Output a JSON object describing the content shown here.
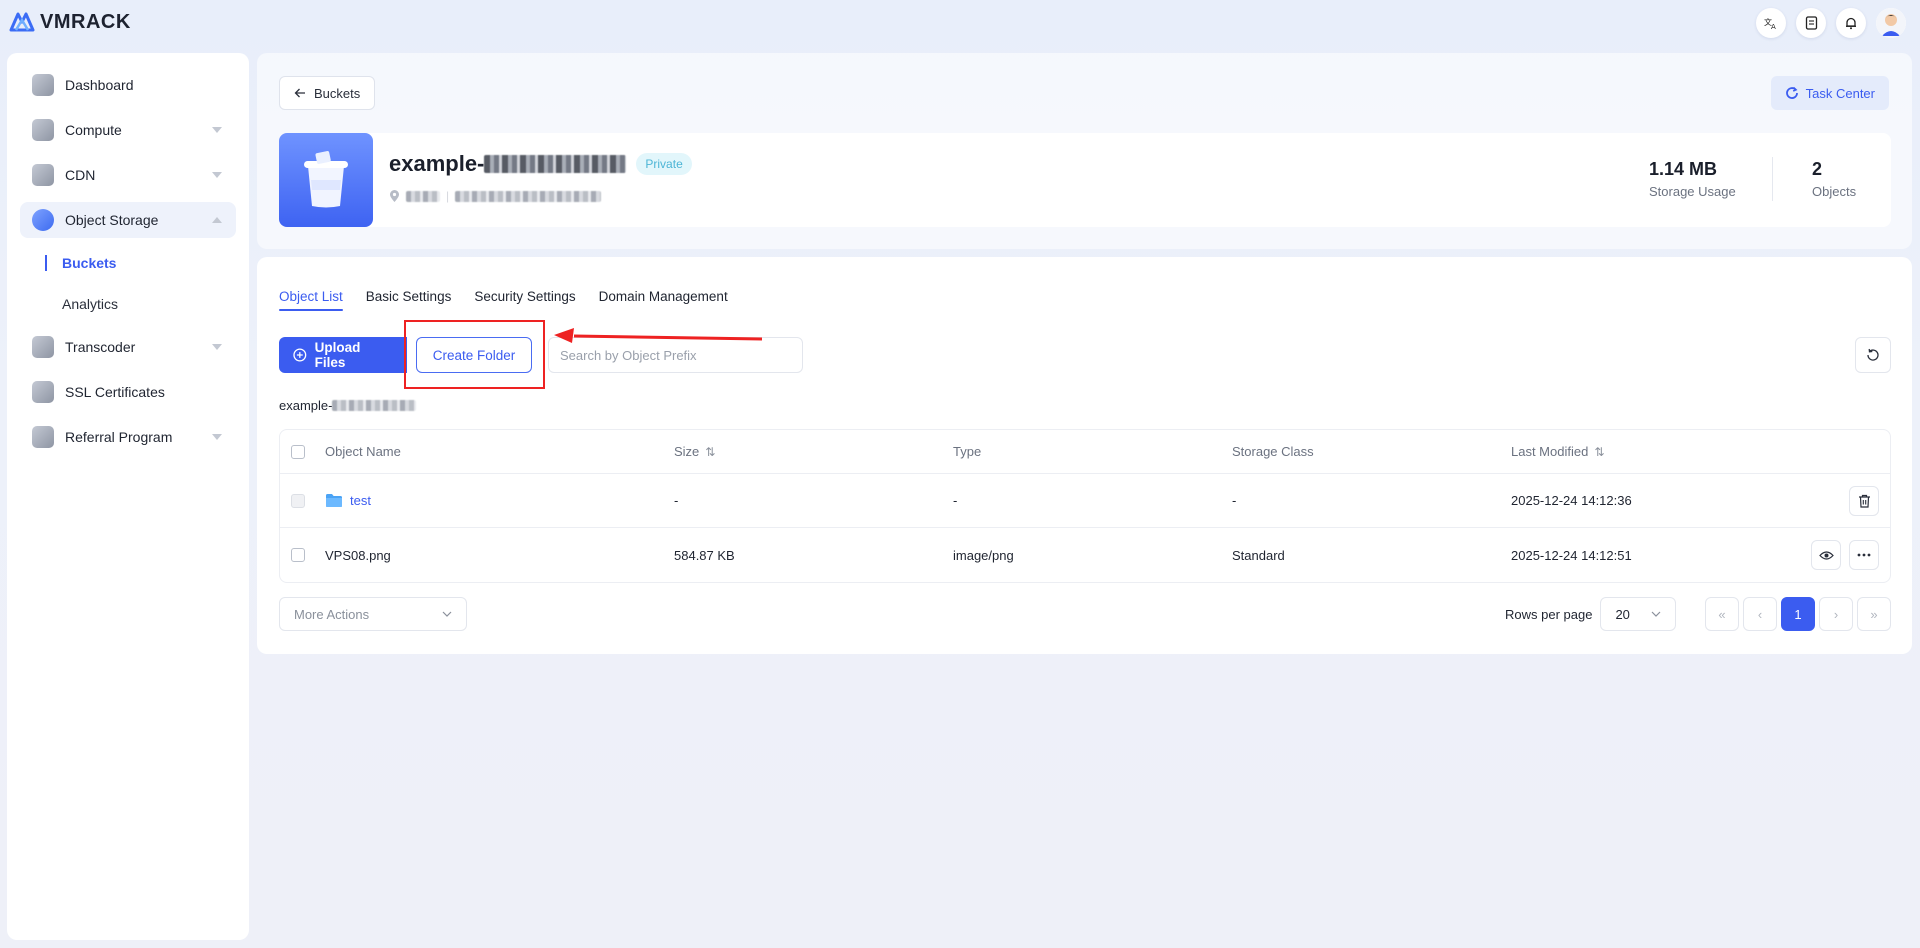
{
  "brand": {
    "name": "VMRACK"
  },
  "topbar": {
    "icons": [
      "translate-icon",
      "document-icon",
      "bell-icon",
      "avatar"
    ]
  },
  "sidebar": {
    "items": [
      {
        "label": "Dashboard",
        "icon": "dashboard-icon",
        "caret": false
      },
      {
        "label": "Compute",
        "icon": "compute-icon",
        "caret": true
      },
      {
        "label": "CDN",
        "icon": "cdn-icon",
        "caret": true
      },
      {
        "label": "Object Storage",
        "icon": "object-storage-icon",
        "caret": true,
        "expanded": true
      },
      {
        "label": "Transcoder",
        "icon": "transcoder-icon",
        "caret": true
      },
      {
        "label": "SSL Certificates",
        "icon": "ssl-icon",
        "caret": false
      },
      {
        "label": "Referral Program",
        "icon": "referral-icon",
        "caret": true
      }
    ],
    "subitems": [
      {
        "label": "Buckets",
        "active": true
      },
      {
        "label": "Analytics",
        "active": false
      }
    ]
  },
  "header": {
    "back_label": "Buckets",
    "task_center_label": "Task Center",
    "bucket_name_prefix": "example-",
    "visibility_badge": "Private",
    "storage_usage_value": "1.14 MB",
    "storage_usage_label": "Storage Usage",
    "objects_value": "2",
    "objects_label": "Objects"
  },
  "tabs": [
    "Object List",
    "Basic Settings",
    "Security Settings",
    "Domain Management"
  ],
  "toolbar": {
    "upload_label": "Upload Files",
    "create_folder_label": "Create Folder",
    "search_placeholder": "Search by Object Prefix"
  },
  "path_prefix": "example-",
  "table": {
    "headers": {
      "name": "Object Name",
      "size": "Size",
      "type": "Type",
      "storage_class": "Storage Class",
      "last_modified": "Last Modified"
    },
    "rows": [
      {
        "name": "test",
        "is_folder": true,
        "size": "-",
        "type": "-",
        "storage_class": "-",
        "last_modified": "2025-12-24 14:12:36"
      },
      {
        "name": "VPS08.png",
        "is_folder": false,
        "size": "584.87 KB",
        "type": "image/png",
        "storage_class": "Standard",
        "last_modified": "2025-12-24 14:12:51"
      }
    ]
  },
  "footer": {
    "more_actions_label": "More Actions",
    "rows_per_page_label": "Rows per page",
    "rows_per_page_value": "20",
    "current_page": "1"
  },
  "colors": {
    "primary": "#3b5cf0",
    "highlight": "#ee2222",
    "badge_text": "#4db5d6"
  }
}
